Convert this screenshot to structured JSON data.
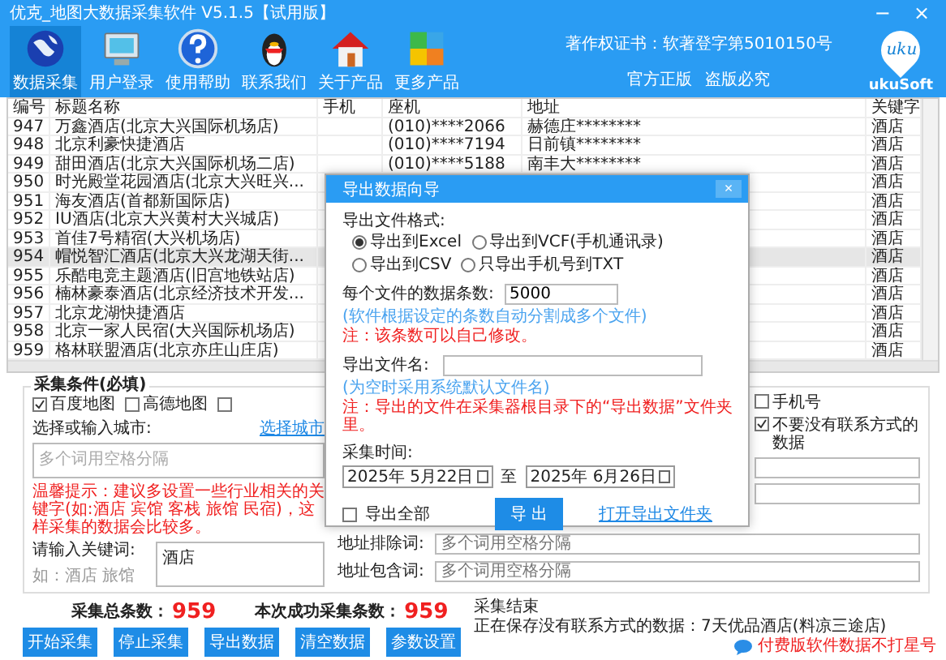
{
  "window": {
    "title": "优克_地图大数据采集软件 V5.1.5【试用版】",
    "minimize": "−",
    "close": "×"
  },
  "toolbar": [
    {
      "label": "数据采集",
      "selected": true
    },
    {
      "label": "用户登录",
      "selected": false
    },
    {
      "label": "使用帮助",
      "selected": false
    },
    {
      "label": "联系我们",
      "selected": false
    },
    {
      "label": "关于产品",
      "selected": false
    },
    {
      "label": "更多产品",
      "selected": false
    }
  ],
  "copyright": "著作权证书：软著登字第5010150号",
  "official": "官方正版",
  "piracy": "盗版必究",
  "logo": {
    "mark": "uku",
    "name": "ukuSoft"
  },
  "table": {
    "columns": [
      "编号",
      "标题名称",
      "手机",
      "座机",
      "地址",
      "关键字"
    ],
    "rows": [
      {
        "cells": [
          "947",
          "万鑫酒店(北京大兴国际机场店)",
          "",
          "(010)****2066",
          "赫德庄********",
          "酒店"
        ],
        "selected": false
      },
      {
        "cells": [
          "948",
          "北京利豪快捷酒店",
          "",
          "(010)****7194",
          "日前镇********",
          "酒店"
        ],
        "selected": false
      },
      {
        "cells": [
          "949",
          "甜田酒店(北京大兴国际机场二店)",
          "",
          "(010)****5188",
          "南丰大********",
          "酒店"
        ],
        "selected": false
      },
      {
        "cells": [
          "950",
          "时光殿堂花园酒店(北京大兴旺兴...",
          "",
          "",
          "",
          "酒店"
        ],
        "selected": false
      },
      {
        "cells": [
          "951",
          "海友酒店(首都新国际店)",
          "",
          "",
          "",
          "酒店"
        ],
        "selected": false
      },
      {
        "cells": [
          "952",
          "IU酒店(北京大兴黄村大兴城店)",
          "",
          "",
          "",
          "酒店"
        ],
        "selected": false
      },
      {
        "cells": [
          "953",
          "首佳7号精宿(大兴机场店)",
          "",
          "",
          "",
          "酒店"
        ],
        "selected": false
      },
      {
        "cells": [
          "954",
          "帽悦智汇酒店(北京大兴龙湖天街...",
          "",
          "",
          "",
          "酒店"
        ],
        "selected": true
      },
      {
        "cells": [
          "955",
          "乐酷电竞主题酒店(旧宫地铁站店)",
          "",
          "",
          "",
          "酒店"
        ],
        "selected": false
      },
      {
        "cells": [
          "956",
          "楠林豪泰酒店(北京经济技术开发...",
          "",
          "",
          "",
          "酒店"
        ],
        "selected": false
      },
      {
        "cells": [
          "957",
          "北京龙湖快捷酒店",
          "",
          "",
          "",
          "酒店"
        ],
        "selected": false
      },
      {
        "cells": [
          "958",
          "北京一家人民宿(大兴国际机场店)",
          "",
          "",
          "",
          "酒店"
        ],
        "selected": false
      },
      {
        "cells": [
          "959",
          "格林联盟酒店(北京亦庄山庄店)",
          "",
          "",
          "",
          "酒店"
        ],
        "selected": false
      }
    ]
  },
  "conditions": {
    "title": "采集条件(必填)",
    "sources": [
      {
        "label": "百度地图",
        "checked": true
      },
      {
        "label": "高德地图",
        "checked": false
      },
      {
        "checked": false
      }
    ],
    "filters": [
      {
        "label": "手机号",
        "checked": false
      },
      {
        "label": "不要没有联系方式的数据",
        "checked": true
      }
    ],
    "city_label": "选择或输入城市:",
    "city_placeholder": "多个词用空格分隔",
    "city_link": "选择城市",
    "tip": "温馨提示：建议多设置一些行业相关的关键字(如:酒店 宾馆 客栈 旅馆 民宿)，这样采集的数据会比较多。",
    "keyword_label": "请输入关键词:",
    "keyword_hint": "如：酒店 旅馆",
    "keyword_value": "酒店",
    "exclude_label": "地址排除词:",
    "exclude_placeholder": "多个词用空格分隔",
    "include_label": "地址包含词:",
    "include_placeholder": "多个词用空格分隔"
  },
  "totals": {
    "total_label": "采集总条数：",
    "total": "959",
    "success_label": "本次成功采集条数：",
    "success": "959"
  },
  "buttons": [
    "开始采集",
    "停止采集",
    "导出数据",
    "清空数据",
    "参数设置"
  ],
  "status": "采集结束",
  "status_detail": "正在保存没有联系方式的数据：7天优品酒店(料凉三途店)",
  "paid_link": "付费版软件数据不打星号",
  "dialog": {
    "title": "导出数据向导",
    "close": "×",
    "format_label": "导出文件格式:",
    "formats": [
      {
        "label": "导出到Excel",
        "selected": true
      },
      {
        "label": "导出到VCF(手机通讯录)",
        "selected": false
      },
      {
        "label": "导出到CSV",
        "selected": false
      },
      {
        "label": "只导出手机号到TXT",
        "selected": false
      }
    ],
    "count_label": "每个文件的数据条数:",
    "count_value": "5000",
    "count_hint": "(软件根据设定的条数自动分割成多个文件)",
    "count_note": "注：该条数可以自己修改。",
    "name_label": "导出文件名:",
    "name_hint": "(为空时采用系统默认文件名)",
    "name_note": "注：导出的文件在采集器根目录下的“导出数据”文件夹里。",
    "time_label": "采集时间:",
    "date_from": "2025年 5月22日",
    "to": "至",
    "date_to": "2025年 6月26日",
    "export_all": {
      "label": "导出全部",
      "checked": false
    },
    "export_button": "导 出",
    "open_folder": "打开导出文件夹"
  }
}
